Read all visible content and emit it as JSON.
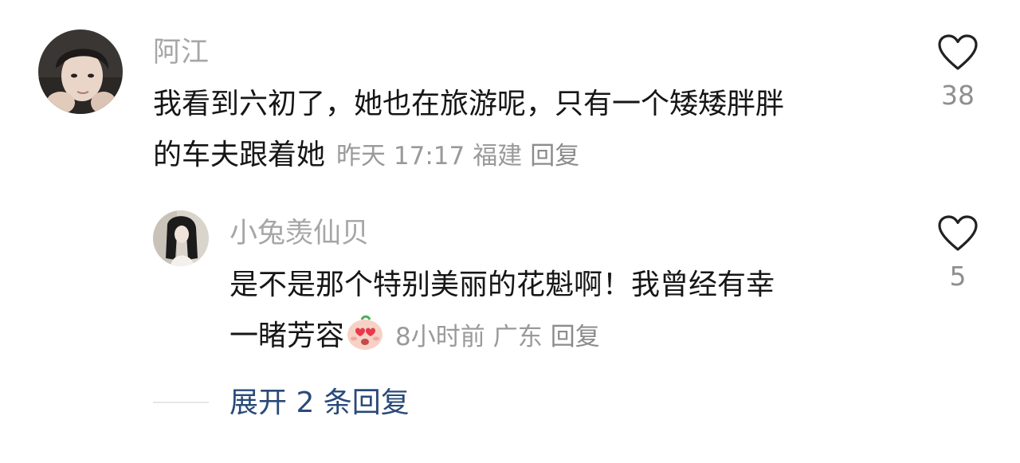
{
  "comments": [
    {
      "username": "阿江",
      "text_line1": "我看到六初了，她也在旅游呢，只有一个矮矮胖胖",
      "text_line2": "的车夫跟着她",
      "time": "昨天 17:17",
      "location": "福建",
      "reply_label": "回复",
      "likes": "38"
    },
    {
      "username": "小兔羡仙贝",
      "text_line1": "是不是那个特别美丽的花魁啊！我曾经有幸",
      "text_line2": "一睹芳容",
      "emoji": "heart-eyes-emoji",
      "time": "8小时前",
      "location": "广东",
      "reply_label": "回复",
      "likes": "5"
    }
  ],
  "expand_replies_label": "展开 2 条回复",
  "colors": {
    "username": "#a6a6a6",
    "comment_text": "#161616",
    "meta": "#9a9a9a",
    "expand_link": "#2a4a78",
    "heart_outline": "#222222"
  }
}
